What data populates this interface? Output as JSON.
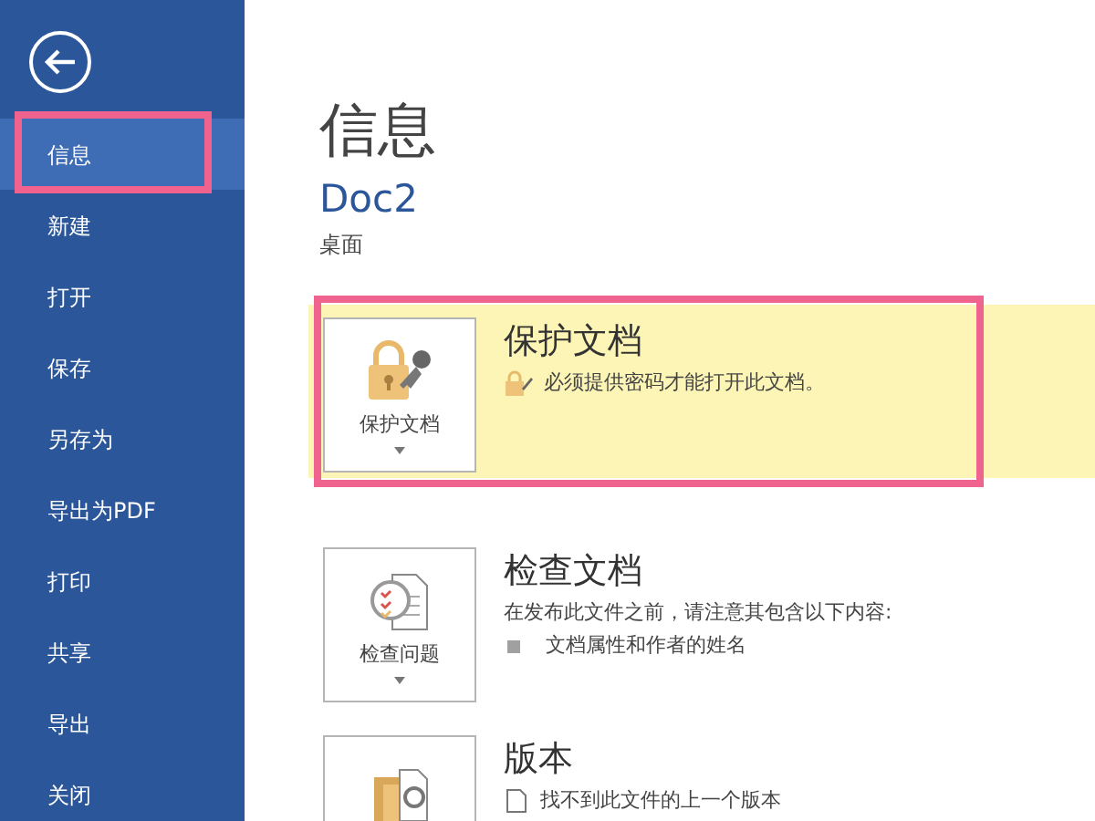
{
  "sidebar": {
    "items": [
      {
        "label": "信息",
        "selected": true,
        "outlined": true
      },
      {
        "label": "新建",
        "selected": false,
        "outlined": false
      },
      {
        "label": "打开",
        "selected": false,
        "outlined": false
      },
      {
        "label": "保存",
        "selected": false,
        "outlined": false
      },
      {
        "label": "另存为",
        "selected": false,
        "outlined": false
      },
      {
        "label": "导出为PDF",
        "selected": false,
        "outlined": false
      },
      {
        "label": "打印",
        "selected": false,
        "outlined": false
      },
      {
        "label": "共享",
        "selected": false,
        "outlined": false
      },
      {
        "label": "导出",
        "selected": false,
        "outlined": false
      },
      {
        "label": "关闭",
        "selected": false,
        "outlined": false
      }
    ]
  },
  "page": {
    "title": "信息",
    "document_name": "Doc2",
    "location": "桌面"
  },
  "sections": [
    {
      "kind": "protect",
      "highlighted": true,
      "outlined": true,
      "button_label": "保护文档",
      "title": "保护文档",
      "lines": [
        {
          "kind": "icon",
          "text": "必须提供密码才能打开此文档。"
        }
      ]
    },
    {
      "kind": "inspect",
      "highlighted": false,
      "outlined": false,
      "button_label": "检查问题",
      "title": "检查文档",
      "lines": [
        {
          "kind": "text",
          "text": "在发布此文件之前，请注意其包含以下内容:"
        },
        {
          "kind": "bullet",
          "text": "文档属性和作者的姓名"
        }
      ]
    },
    {
      "kind": "versions",
      "highlighted": false,
      "outlined": false,
      "title": "版本",
      "lines": [
        {
          "kind": "icon",
          "text": "找不到此文件的上一个版本"
        }
      ]
    }
  ]
}
